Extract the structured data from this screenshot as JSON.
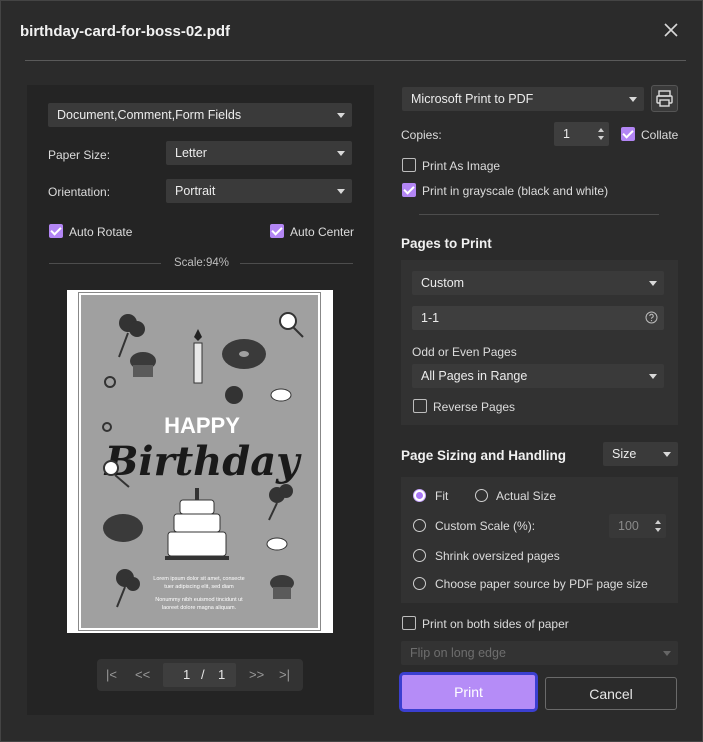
{
  "dialog": {
    "title": "birthday-card-for-boss-02.pdf"
  },
  "left": {
    "content_select": "Document,Comment,Form Fields",
    "paper_size_label": "Paper Size:",
    "paper_size_value": "Letter",
    "orientation_label": "Orientation:",
    "orientation_value": "Portrait",
    "auto_rotate": {
      "label": "Auto Rotate",
      "checked": true
    },
    "auto_center": {
      "label": "Auto Center",
      "checked": true
    },
    "scale": "Scale:94%",
    "preview": {
      "happy": "HAPPY",
      "birthday": "Birthday",
      "text_a1": "Lorem ipsum dolor sit amet, consecte",
      "text_a2": "tuer adipiscing elit, sed diam",
      "text_b1": "Nonummy nibh euismod tincidunt ut",
      "text_b2": "laoreet dolore magna aliquam."
    },
    "pager": {
      "first": "|<",
      "prev": "<<",
      "current": "1",
      "sep": "/",
      "total": "1",
      "next": ">>",
      "last": ">|"
    }
  },
  "right": {
    "printer": "Microsoft Print to PDF",
    "copies_label": "Copies:",
    "copies_value": "1",
    "collate": {
      "label": "Collate",
      "checked": true
    },
    "print_as_image": {
      "label": "Print As Image",
      "checked": false
    },
    "grayscale": {
      "label": "Print in grayscale (black and white)",
      "checked": true
    },
    "pages_to_print": {
      "heading": "Pages to Print",
      "range_type": "Custom",
      "range_value": "1-1",
      "odd_even_label": "Odd or Even Pages",
      "odd_even_value": "All Pages in Range",
      "reverse": {
        "label": "Reverse Pages",
        "checked": false
      }
    },
    "sizing": {
      "heading": "Page Sizing and Handling",
      "mode": "Size",
      "fit": "Fit",
      "actual_size": "Actual Size",
      "custom_scale": "Custom Scale (%):",
      "custom_scale_value": "100",
      "shrink": "Shrink oversized pages",
      "paper_source": "Choose paper source by PDF page size"
    },
    "both_sides": {
      "label": "Print on both sides of paper",
      "checked": false
    },
    "flip": "Flip on long edge"
  },
  "buttons": {
    "print": "Print",
    "cancel": "Cancel"
  },
  "colors": {
    "accent": "#b58cf7",
    "focus_ring": "#3b3fd0",
    "background": "#2b2b2b"
  }
}
